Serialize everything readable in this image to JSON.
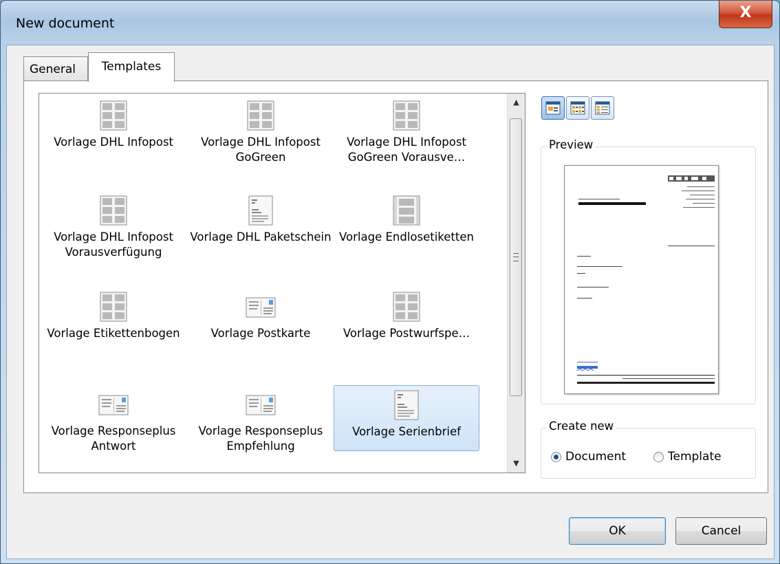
{
  "window": {
    "title": "New document",
    "close_glyph": "X"
  },
  "tabs": [
    {
      "label": "General"
    },
    {
      "label": "Templates"
    }
  ],
  "templates": [
    {
      "label": "Vorlage DHL Infopost",
      "icon": "label-sheet-icon"
    },
    {
      "label": "Vorlage DHL Infopost GoGreen",
      "icon": "label-sheet-icon"
    },
    {
      "label": "Vorlage DHL Infopost GoGreen Vorausve…",
      "icon": "label-sheet-icon"
    },
    {
      "label": "Vorlage DHL Infopost Vorausverfügung",
      "icon": "label-sheet-icon"
    },
    {
      "label": "Vorlage DHL Paketschein",
      "icon": "letter-document-icon"
    },
    {
      "label": "Vorlage Endlosetiketten",
      "icon": "continuous-labels-icon"
    },
    {
      "label": "Vorlage Etikettenbogen",
      "icon": "label-sheet-icon"
    },
    {
      "label": "Vorlage Postkarte",
      "icon": "postcard-icon"
    },
    {
      "label": "Vorlage Postwurfspe…",
      "icon": "label-sheet-icon"
    },
    {
      "label": "Vorlage Responseplus Antwort",
      "icon": "postcard-icon"
    },
    {
      "label": "Vorlage Responseplus Empfehlung",
      "icon": "postcard-icon"
    },
    {
      "label": "Vorlage Serienbrief",
      "icon": "letter-document-icon",
      "selected": true
    }
  ],
  "view_buttons": [
    {
      "name": "large-icons-view",
      "active": true
    },
    {
      "name": "small-icons-view",
      "active": false
    },
    {
      "name": "details-view",
      "active": false
    }
  ],
  "preview": {
    "label": "Preview"
  },
  "create_new": {
    "label": "Create new",
    "options": [
      {
        "label": "Document",
        "checked": true
      },
      {
        "label": "Template",
        "checked": false
      }
    ]
  },
  "buttons": {
    "ok": "OK",
    "cancel": "Cancel"
  },
  "colors": {
    "selection_bg": "#cfe3f8",
    "selection_border": "#84acdd",
    "close_button": "#c2361a"
  }
}
